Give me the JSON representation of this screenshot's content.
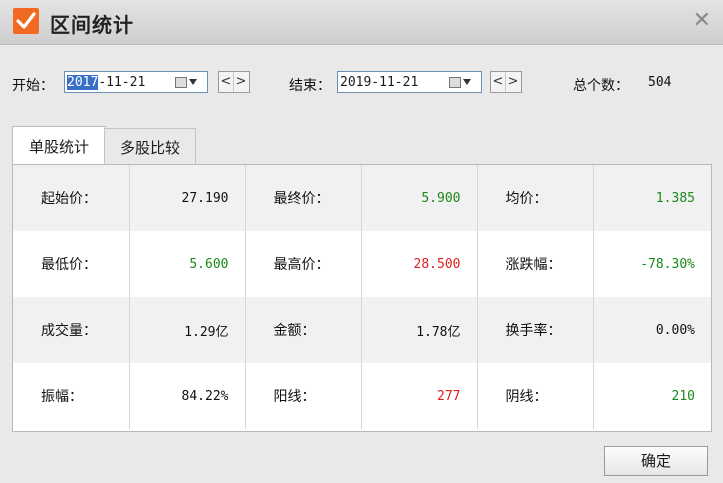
{
  "window": {
    "title": "区间统计",
    "close_glyph": "✕"
  },
  "range": {
    "start_label": "开始：",
    "start_year_selected": "2017",
    "start_rest": "-11-21",
    "end_label": "结束：",
    "end_date": "2019-11-21",
    "prev_glyph": "<",
    "next_glyph": ">",
    "count_label": "总个数：",
    "count_value": "504"
  },
  "tabs": [
    {
      "label": "单股统计",
      "active": true
    },
    {
      "label": "多股比较",
      "active": false
    }
  ],
  "stats": [
    [
      {
        "k": "起始价：",
        "v": "27.190",
        "c": "black"
      },
      {
        "k": "最终价：",
        "v": "5.900",
        "c": "green"
      },
      {
        "k": "均价：",
        "v": "1.385",
        "c": "green"
      }
    ],
    [
      {
        "k": "最低价：",
        "v": "5.600",
        "c": "green"
      },
      {
        "k": "最高价：",
        "v": "28.500",
        "c": "red"
      },
      {
        "k": "涨跌幅：",
        "v": "-78.30%",
        "c": "green"
      }
    ],
    [
      {
        "k": "成交量：",
        "v": "1.29亿",
        "c": "black"
      },
      {
        "k": "金额：",
        "v": "1.78亿",
        "c": "black"
      },
      {
        "k": "换手率：",
        "v": "0.00%",
        "c": "black"
      }
    ],
    [
      {
        "k": "振幅：",
        "v": "84.22%",
        "c": "black"
      },
      {
        "k": "阳线：",
        "v": "277",
        "c": "red"
      },
      {
        "k": "阴线：",
        "v": "210",
        "c": "green"
      }
    ]
  ],
  "footer": {
    "ok_label": "确定"
  },
  "colors": {
    "accent": "#f26a21",
    "up": "#e02020",
    "down": "#1a8a1a",
    "selection": "#3a6fc7"
  }
}
